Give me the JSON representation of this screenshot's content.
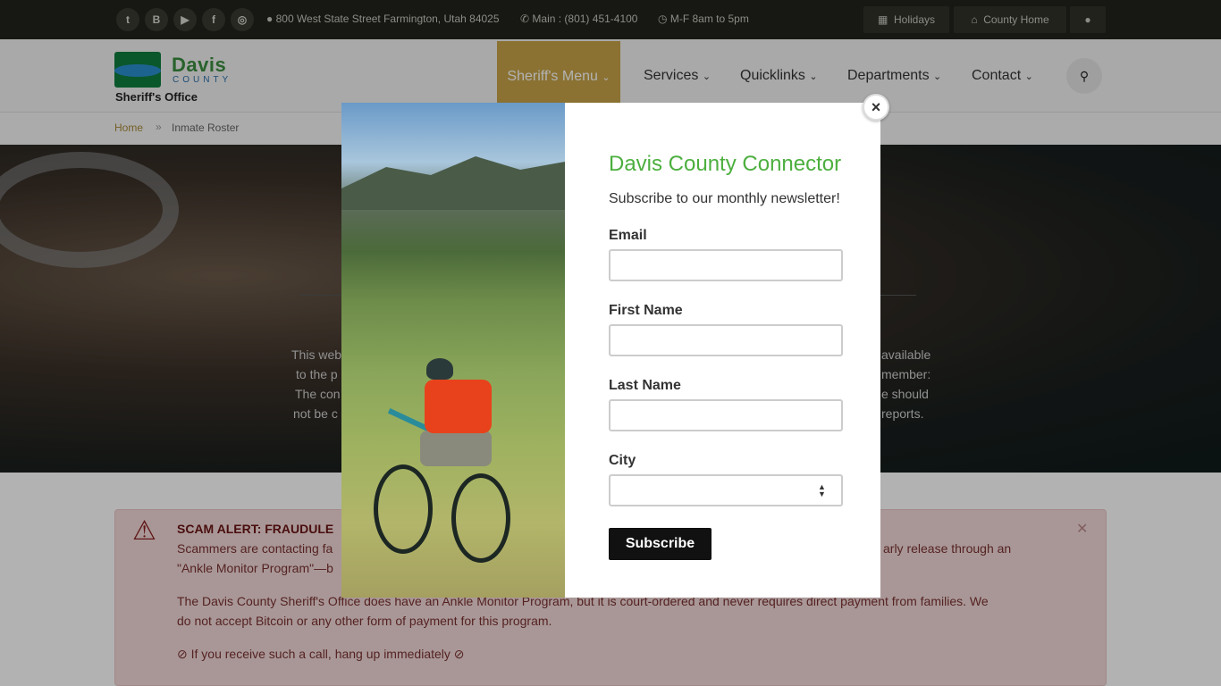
{
  "topbar": {
    "social": [
      {
        "name": "twitter-icon",
        "glyph": "t"
      },
      {
        "name": "blog-icon",
        "glyph": "B"
      },
      {
        "name": "youtube-icon",
        "glyph": "▶"
      },
      {
        "name": "facebook-icon",
        "glyph": "f"
      },
      {
        "name": "instagram-icon",
        "glyph": "◎"
      }
    ],
    "address": "800 West State Street Farmington, Utah 84025",
    "phone": "Main : (801) 451-4100",
    "hours": "M-F 8am to 5pm",
    "holidays_label": "Holidays",
    "county_home_label": "County Home"
  },
  "logo": {
    "davis": "Davis",
    "county": "COUNTY",
    "sheriff": "Sheriff's Office"
  },
  "nav": {
    "active": "Sheriff's Menu",
    "items": [
      "Services",
      "Quicklinks",
      "Departments",
      "Contact"
    ]
  },
  "breadcrumb": {
    "home": "Home",
    "sep": "»",
    "current": "Inmate Roster"
  },
  "hero": {
    "line1a": "This web",
    "line1b": "available",
    "line2a": "to the p",
    "line2b": "member:",
    "line3a": "The con",
    "line3b": "e should",
    "line4a": "not be c",
    "line4b": "reports."
  },
  "alert": {
    "title": "SCAM ALERT: FRAUDULE",
    "body1a": "Scammers are contacting fa",
    "body1b": "arly release through an",
    "body2": "\"Ankle Monitor Program\"—b",
    "body3": "The Davis County Sheriff's Office does have an Ankle Monitor Program, but it is court-ordered and never requires direct payment from families. We",
    "body4": "do not accept Bitcoin or any other form of payment for this program.",
    "body5": "If you receive such a call, hang up immediately"
  },
  "modal": {
    "title": "Davis County Connector",
    "subtitle": "Subscribe to our monthly newsletter!",
    "email_label": "Email",
    "first_label": "First Name",
    "last_label": "Last Name",
    "city_label": "City",
    "subscribe_label": "Subscribe",
    "close_glyph": "×"
  },
  "colors": {
    "accent": "#c8a44a",
    "connector_green": "#4caf3e",
    "topbar": "#22221c"
  }
}
